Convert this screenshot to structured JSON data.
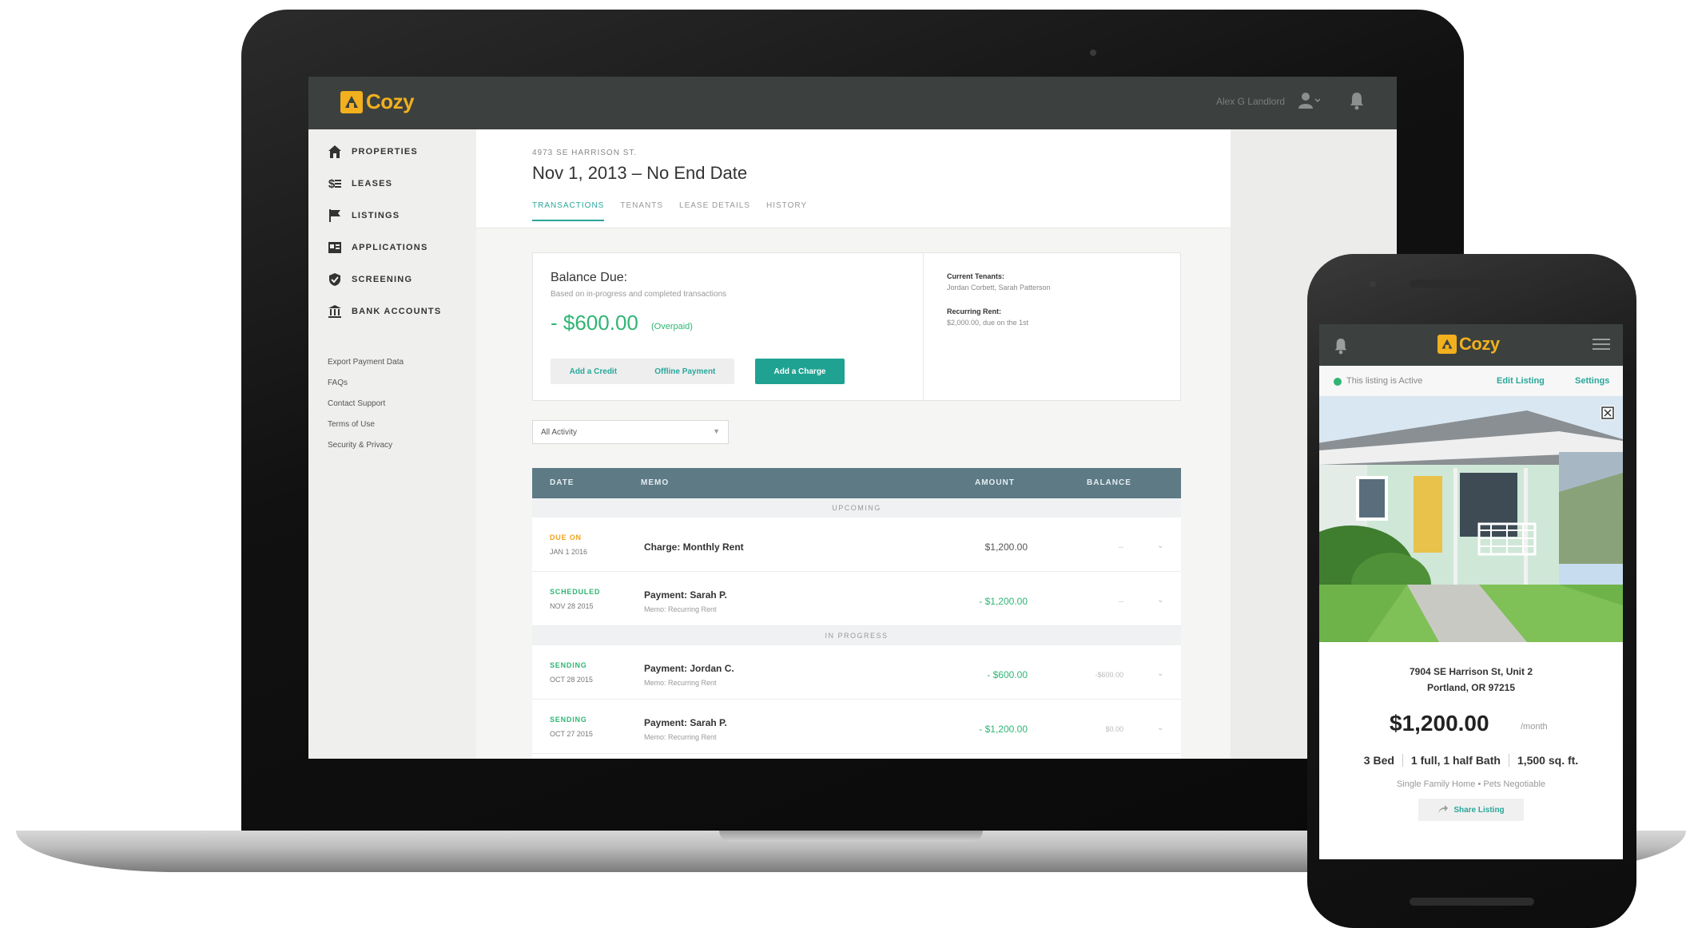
{
  "app": {
    "brand": "Cozy",
    "user_name": "Alex G Landlord",
    "colors": {
      "brand_yellow": "#f2b01e",
      "topbar": "#3c413f",
      "teal": "#1fa291",
      "green": "#2fb574",
      "orange": "#f0a21c"
    }
  },
  "sidebar": {
    "items": [
      {
        "label": "PROPERTIES",
        "icon": "house-icon"
      },
      {
        "label": "LEASES",
        "icon": "dollar-list-icon"
      },
      {
        "label": "LISTINGS",
        "icon": "flag-icon"
      },
      {
        "label": "APPLICATIONS",
        "icon": "application-card-icon"
      },
      {
        "label": "SCREENING",
        "icon": "shield-check-icon"
      },
      {
        "label": "BANK ACCOUNTS",
        "icon": "bank-icon"
      }
    ],
    "links": [
      "Export Payment Data",
      "FAQs",
      "Contact Support",
      "Terms of Use",
      "Security & Privacy"
    ]
  },
  "lease": {
    "address": "4973 SE HARRISON ST.",
    "date_range": "Nov 1, 2013 – No End Date",
    "tabs": [
      "TRANSACTIONS",
      "TENANTS",
      "LEASE DETAILS",
      "HISTORY"
    ]
  },
  "balance": {
    "title": "Balance Due:",
    "subtitle": "Based on in-progress and completed transactions",
    "amount": "- $600.00",
    "note": "(Overpaid)",
    "add_credit": "Add a Credit",
    "offline_payment": "Offline Payment",
    "add_charge": "Add a Charge",
    "tenants_label": "Current Tenants:",
    "tenants_value": "Jordan Corbett, Sarah Patterson",
    "rent_label": "Recurring Rent:",
    "rent_value": "$2,000.00, due on the 1st"
  },
  "filter": {
    "value": "All Activity"
  },
  "table": {
    "headers": [
      "DATE",
      "MEMO",
      "AMOUNT",
      "BALANCE"
    ],
    "groups": [
      "UPCOMING",
      "IN PROGRESS"
    ],
    "rows": [
      {
        "status": "DUE ON",
        "date": "JAN 1 2016",
        "memo": "Charge: Monthly Rent",
        "sub": "",
        "amount": "$1,200.00",
        "balance": "--"
      },
      {
        "status": "SCHEDULED",
        "date": "NOV 28 2015",
        "memo": "Payment: Sarah P.",
        "sub": "Memo: Recurring Rent",
        "amount": "- $1,200.00",
        "balance": "--"
      },
      {
        "status": "SENDING",
        "date": "OCT 28 2015",
        "memo": "Payment: Jordan C.",
        "sub": "Memo: Recurring Rent",
        "amount": "- $600.00",
        "balance": "-$600.00"
      },
      {
        "status": "SENDING",
        "date": "OCT 27 2015",
        "memo": "Payment: Sarah P.",
        "sub": "Memo: Recurring Rent",
        "amount": "- $1,200.00",
        "balance": "$0.00"
      }
    ]
  },
  "phone": {
    "status_text": "This listing is Active",
    "edit_listing": "Edit Listing",
    "settings": "Settings",
    "address_line1": "7904 SE Harrison St, Unit 2",
    "address_line2": "Portland, OR 97215",
    "price": "$1,200.00",
    "per": "/month",
    "beds": "3 Bed",
    "baths": "1 full, 1 half Bath",
    "sqft": "1,500 sq. ft.",
    "type_line": "Single Family Home  •  Pets Negotiable",
    "share": "Share Listing"
  }
}
